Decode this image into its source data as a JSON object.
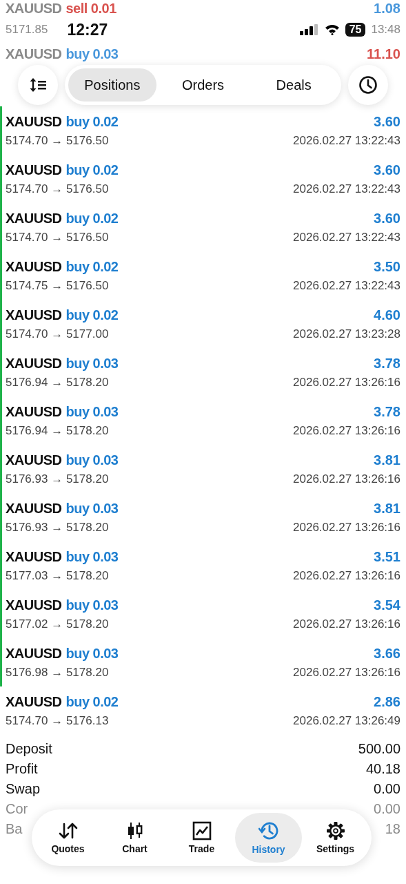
{
  "status_bar": {
    "time": "12:27",
    "battery": "75"
  },
  "behind_rows": [
    {
      "symbol": "XAUUSD",
      "color": "#d9534f",
      "trade": "sell 0.01",
      "profit": "1.08",
      "loss": false,
      "prices": "5171.85",
      "time_fragment": "13:48"
    },
    {
      "symbol": "XAUUSD",
      "color": "#4a98dc",
      "trade": "buy 0.03",
      "profit": "11.10",
      "loss": true
    }
  ],
  "tabs": [
    {
      "label": "Positions",
      "selected": true
    },
    {
      "label": "Orders",
      "selected": false
    },
    {
      "label": "Deals",
      "selected": false
    }
  ],
  "rows": [
    {
      "symbol": "XAUUSD",
      "trade": "buy 0.02",
      "profit": "3.60",
      "prices": "5174.70 → 5176.50",
      "time": "2026.02.27 13:22:43",
      "grouped": true
    },
    {
      "symbol": "XAUUSD",
      "trade": "buy 0.02",
      "profit": "3.60",
      "prices": "5174.70 → 5176.50",
      "time": "2026.02.27 13:22:43",
      "grouped": true
    },
    {
      "symbol": "XAUUSD",
      "trade": "buy 0.02",
      "profit": "3.60",
      "prices": "5174.70 → 5176.50",
      "time": "2026.02.27 13:22:43",
      "grouped": true
    },
    {
      "symbol": "XAUUSD",
      "trade": "buy 0.02",
      "profit": "3.50",
      "prices": "5174.75 → 5176.50",
      "time": "2026.02.27 13:22:43",
      "grouped": true
    },
    {
      "symbol": "XAUUSD",
      "trade": "buy 0.02",
      "profit": "4.60",
      "prices": "5174.70 → 5177.00",
      "time": "2026.02.27 13:23:28",
      "grouped": true
    },
    {
      "symbol": "XAUUSD",
      "trade": "buy 0.03",
      "profit": "3.78",
      "prices": "5176.94 → 5178.20",
      "time": "2026.02.27 13:26:16",
      "grouped": true
    },
    {
      "symbol": "XAUUSD",
      "trade": "buy 0.03",
      "profit": "3.78",
      "prices": "5176.94 → 5178.20",
      "time": "2026.02.27 13:26:16",
      "grouped": true
    },
    {
      "symbol": "XAUUSD",
      "trade": "buy 0.03",
      "profit": "3.81",
      "prices": "5176.93 → 5178.20",
      "time": "2026.02.27 13:26:16",
      "grouped": true
    },
    {
      "symbol": "XAUUSD",
      "trade": "buy 0.03",
      "profit": "3.81",
      "prices": "5176.93 → 5178.20",
      "time": "2026.02.27 13:26:16",
      "grouped": true
    },
    {
      "symbol": "XAUUSD",
      "trade": "buy 0.03",
      "profit": "3.51",
      "prices": "5177.03 → 5178.20",
      "time": "2026.02.27 13:26:16",
      "grouped": true
    },
    {
      "symbol": "XAUUSD",
      "trade": "buy 0.03",
      "profit": "3.54",
      "prices": "5177.02 → 5178.20",
      "time": "2026.02.27 13:26:16",
      "grouped": true
    },
    {
      "symbol": "XAUUSD",
      "trade": "buy 0.03",
      "profit": "3.66",
      "prices": "5176.98 → 5178.20",
      "time": "2026.02.27 13:26:16",
      "grouped": true
    },
    {
      "symbol": "XAUUSD",
      "trade": "buy 0.02",
      "profit": "2.86",
      "prices": "5174.70 → 5176.13",
      "time": "2026.02.27 13:26:49",
      "grouped": false
    }
  ],
  "summary": [
    {
      "label": "Deposit",
      "value": "500.00"
    },
    {
      "label": "Profit",
      "value": "40.18"
    },
    {
      "label": "Swap",
      "value": "0.00"
    }
  ],
  "summary_behind": [
    {
      "label": "Cor",
      "value": "0.00"
    },
    {
      "label": "Ba",
      "value": "18"
    }
  ],
  "nav": [
    {
      "label": "Quotes",
      "selected": false
    },
    {
      "label": "Chart",
      "selected": false
    },
    {
      "label": "Trade",
      "selected": false
    },
    {
      "label": "History",
      "selected": true
    },
    {
      "label": "Settings",
      "selected": false
    }
  ]
}
